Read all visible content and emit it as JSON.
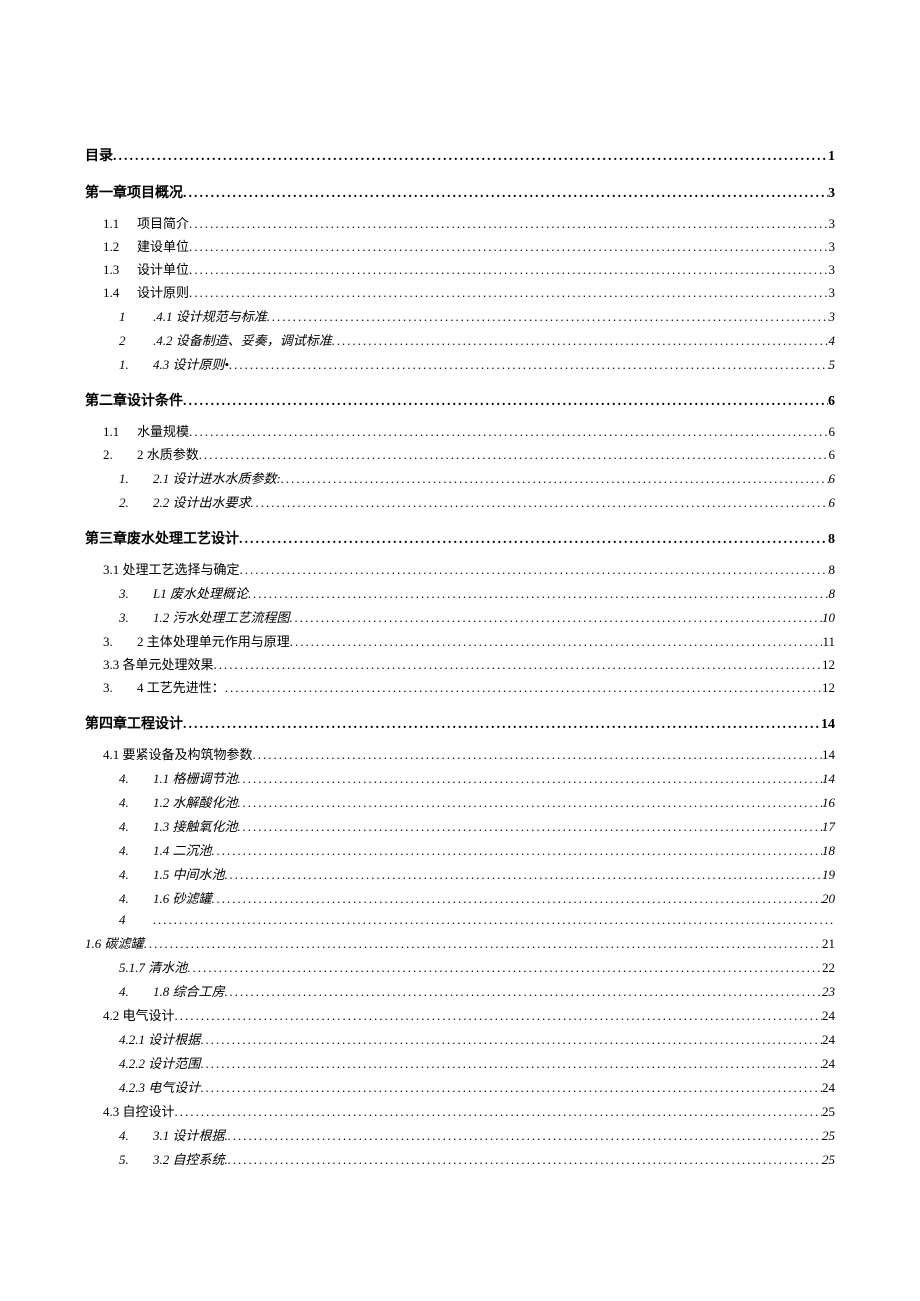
{
  "toc": {
    "t0": "目录",
    "p0": "1",
    "t1": "第一章项目概况",
    "p1": "3",
    "n11": "1.1",
    "t11": "项目简介",
    "p11": "3",
    "n12": "1.2",
    "t12": "建设单位",
    "p12": "3",
    "n13": "1.3",
    "t13": "设计单位",
    "p13": "3",
    "n14": "1.4",
    "t14": "设计原则",
    "p14": "3",
    "n141": "1",
    "t141": ".4.1 设计规范与标准",
    "p141": "3",
    "n142": "2",
    "t142": ".4.2 设备制造、妥奏，调试标准",
    "p142": "4",
    "n143": "1.",
    "t143": "4.3 设计原则•",
    "p143": "5",
    "t2": "第二章设计条件",
    "p2": "6",
    "n21": "1.1",
    "t21": "水量规模",
    "p21": "6",
    "n22": "2.",
    "t22": "2 水质参数",
    "p22": "6",
    "n221": "1.",
    "t221": "2.1 设计进水水质参数:",
    "p221": "6",
    "n222": "2.",
    "t222": "2.2 设计出水要求",
    "p222": "6",
    "t3": "第三章废水处理工艺设计",
    "p3": "8",
    "t31": "3.1 处理工艺选择与确定",
    "p31": "8",
    "n311": "3.",
    "t311": "L1 废水处理概论",
    "p311": "8",
    "n312": "3.",
    "t312": "1.2 污水处理工艺流程图",
    "p312": "10",
    "n32": "3.",
    "t32": "2 主体处理单元作用与原理",
    "p32": "11",
    "t33": "3.3 各单元处理效果",
    "p33": "12",
    "n34": "3.",
    "t34": "4 工艺先进性：",
    "p34": "12",
    "t4": "第四章工程设计",
    "p4": "14",
    "t41": "4.1 要紧设备及构筑物参数",
    "p41": "14",
    "n411": "4.",
    "t411": "1.1 格栅调节池",
    "p411": "14",
    "n412": "4.",
    "t412": "1.2 水解酸化池",
    "p412": "16",
    "n413": "4.",
    "t413": "1.3 接触氧化池",
    "p413": "17",
    "n414": "4.",
    "t414": "1.4 二沉池",
    "p414": "18",
    "n415": "4.",
    "t415": "1.5 中间水池",
    "p415": "19",
    "n416": "4.",
    "t416": "1.6 砂滤罐",
    "p416": "20",
    "n417a": "4",
    "p417a": "",
    "t417": "1.6 碳滤罐",
    "p417": "21",
    "t418": "5.1.7 清水池",
    "p418": "22",
    "n419": "4.",
    "t419": "1.8 综合工房",
    "p419": "23",
    "t42": "4.2 电气设计",
    "p42": "24",
    "t421": "4.2.1 设计根据",
    "p421": "24",
    "t422": "4.2.2 设计范围",
    "p422": "24",
    "t423": "4.2.3 电气设计",
    "p423": "24",
    "t43": "4.3 自控设计",
    "p43": "25",
    "n431": "4.",
    "t431": "3.1 设计根据.",
    "p431": "25",
    "n432": "5.",
    "t432": "3.2 自控系统.",
    "p432": "25"
  }
}
